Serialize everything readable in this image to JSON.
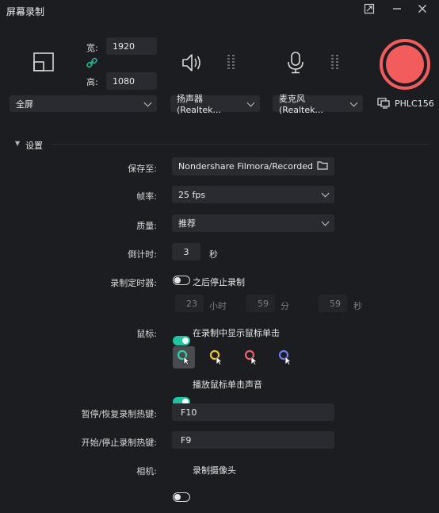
{
  "app": {
    "title": "屏幕录制"
  },
  "size": {
    "width_label": "宽:",
    "width_value": "1920",
    "height_label": "高:",
    "height_value": "1080"
  },
  "sources": {
    "screen": "全屏",
    "speaker": "扬声器 (Realtek...",
    "mic": "麦克风 (Realtek...",
    "monitor": "PHLC156"
  },
  "settings": {
    "header": "设置",
    "save_label": "保存至:",
    "save_path": "Nondershare Filmora/Recorded",
    "fps_label": "帧率:",
    "fps_value": "25 fps",
    "quality_label": "质量:",
    "quality_value": "推荐",
    "countdown_label": "倒计时:",
    "countdown_value": "3",
    "countdown_unit": "秒",
    "timer_label": "录制定时器:",
    "timer_toggle_text": "之后停止录制",
    "timer_hours": "23",
    "timer_hours_unit": "小时",
    "timer_minutes": "59",
    "timer_minutes_unit": "分",
    "timer_seconds": "59",
    "timer_seconds_unit": "秒",
    "mouse_label": "鼠标:",
    "mouse_show_clicks": "在录制中显示鼠标单击",
    "mouse_click_sound": "播放鼠标单击声音",
    "pause_hotkey_label": "暂停/恢复录制热键:",
    "pause_hotkey_value": "F10",
    "start_hotkey_label": "开始/停止录制热键:",
    "start_hotkey_value": "F9",
    "camera_label": "相机:",
    "camera_toggle_text": "录制摄像头"
  },
  "toggles": {
    "timer": false,
    "show_clicks": true,
    "click_sound": true,
    "camera": false
  },
  "cursor_colors": [
    "#2bd3a6",
    "#f2c233",
    "#f0606a",
    "#6d7cf0"
  ],
  "colors": {
    "accent": "#20c4a0",
    "record": "#f25c5c"
  }
}
